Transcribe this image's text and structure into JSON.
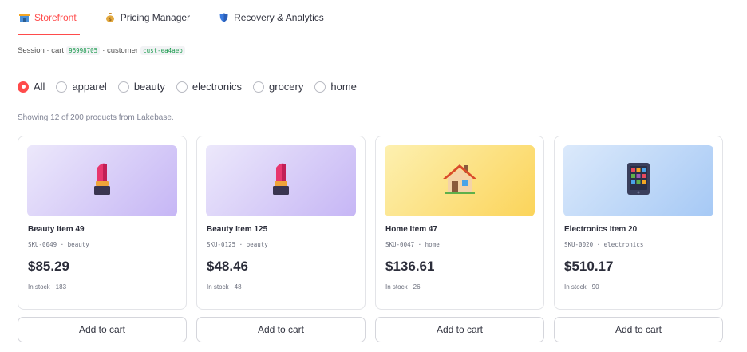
{
  "tabs": [
    {
      "label": "Storefront",
      "icon": "storefront-icon",
      "active": true
    },
    {
      "label": "Pricing Manager",
      "icon": "money-bag-icon",
      "active": false
    },
    {
      "label": "Recovery & Analytics",
      "icon": "shield-icon",
      "active": false
    }
  ],
  "session": {
    "prefix": "Session · cart",
    "cart_id": "96998705",
    "customer_label": "· customer",
    "customer_id": "cust-ea4aeb"
  },
  "filters": {
    "options": [
      "All",
      "apparel",
      "beauty",
      "electronics",
      "grocery",
      "home"
    ],
    "selected": "All"
  },
  "showing_text": "Showing 12 of 200 products from Lakebase.",
  "products": [
    {
      "name": "Beauty Item 49",
      "sku": "SKU-0049 · beauty",
      "price": "$85.29",
      "stock": "In stock · 183",
      "icon": "lipstick-icon",
      "theme": "purple"
    },
    {
      "name": "Beauty Item 125",
      "sku": "SKU-0125 · beauty",
      "price": "$48.46",
      "stock": "In stock · 48",
      "icon": "lipstick-icon",
      "theme": "purple"
    },
    {
      "name": "Home Item 47",
      "sku": "SKU-0047 · home",
      "price": "$136.61",
      "stock": "In stock · 26",
      "icon": "house-icon",
      "theme": "yellow"
    },
    {
      "name": "Electronics Item 20",
      "sku": "SKU-0020 · electronics",
      "price": "$510.17",
      "stock": "In stock · 90",
      "icon": "tablet-icon",
      "theme": "blue"
    }
  ],
  "add_to_cart_label": "Add to cart",
  "colors": {
    "accent": "#ff4b4b",
    "code_text": "#1d9c4f"
  }
}
